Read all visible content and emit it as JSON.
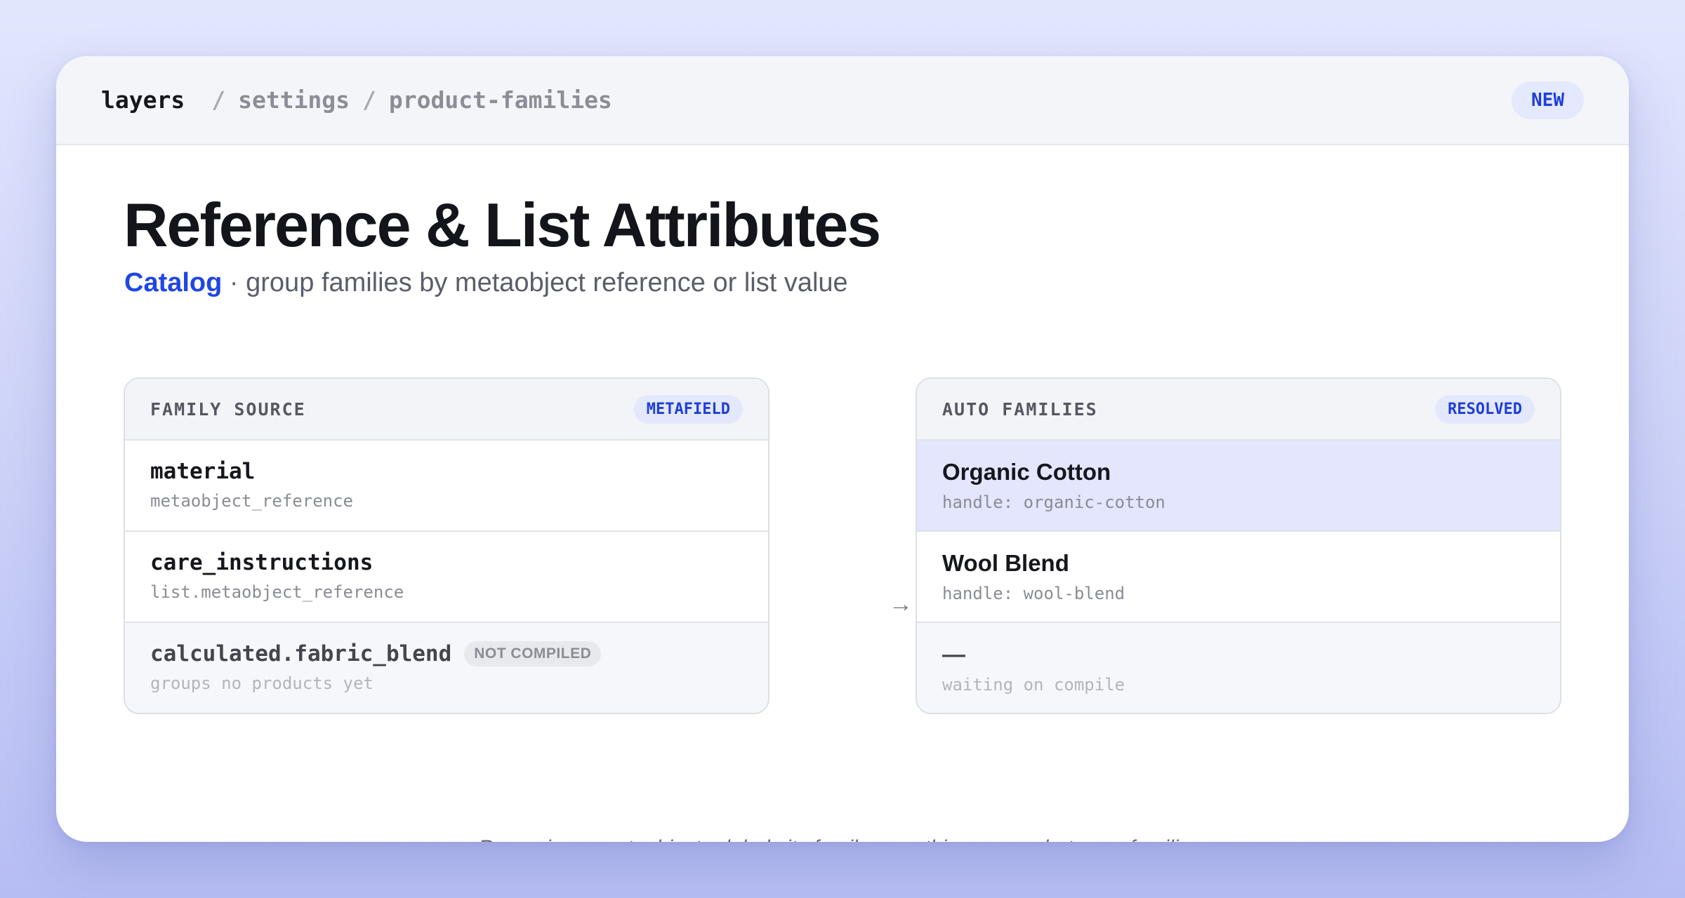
{
  "breadcrumb": {
    "root": "layers",
    "separator": "/",
    "items": [
      "settings",
      "product-families"
    ]
  },
  "badge_new": "NEW",
  "title": "Reference & List Attributes",
  "subtitle": {
    "link": "Catalog",
    "text": "· group families by metaobject reference or list value"
  },
  "source_panel": {
    "title": "FAMILY SOURCE",
    "badge": "METAFIELD",
    "rows": [
      {
        "name": "material",
        "type": "metaobject_reference"
      },
      {
        "name": "care_instructions",
        "type": "list.metaobject_reference"
      },
      {
        "name": "calculated.fabric_blend",
        "badge": "NOT COMPILED",
        "type": "groups no products yet"
      }
    ]
  },
  "arrow_icon": "→",
  "families_panel": {
    "title": "AUTO FAMILIES",
    "badge": "RESOLVED",
    "rows": [
      {
        "name": "Organic Cotton",
        "handle": "handle: organic-cotton"
      },
      {
        "name": "Wool Blend",
        "handle": "handle: wool-blend"
      },
      {
        "name": "—",
        "handle": "waiting on compile"
      }
    ]
  },
  "footer_note": "Renaming a metaobject relabels its family — nothing moves between families.",
  "colors": {
    "accent": "#1f46e5",
    "highlight_row": "#e3e6fd",
    "badge_bg": "#e3e8fd"
  }
}
